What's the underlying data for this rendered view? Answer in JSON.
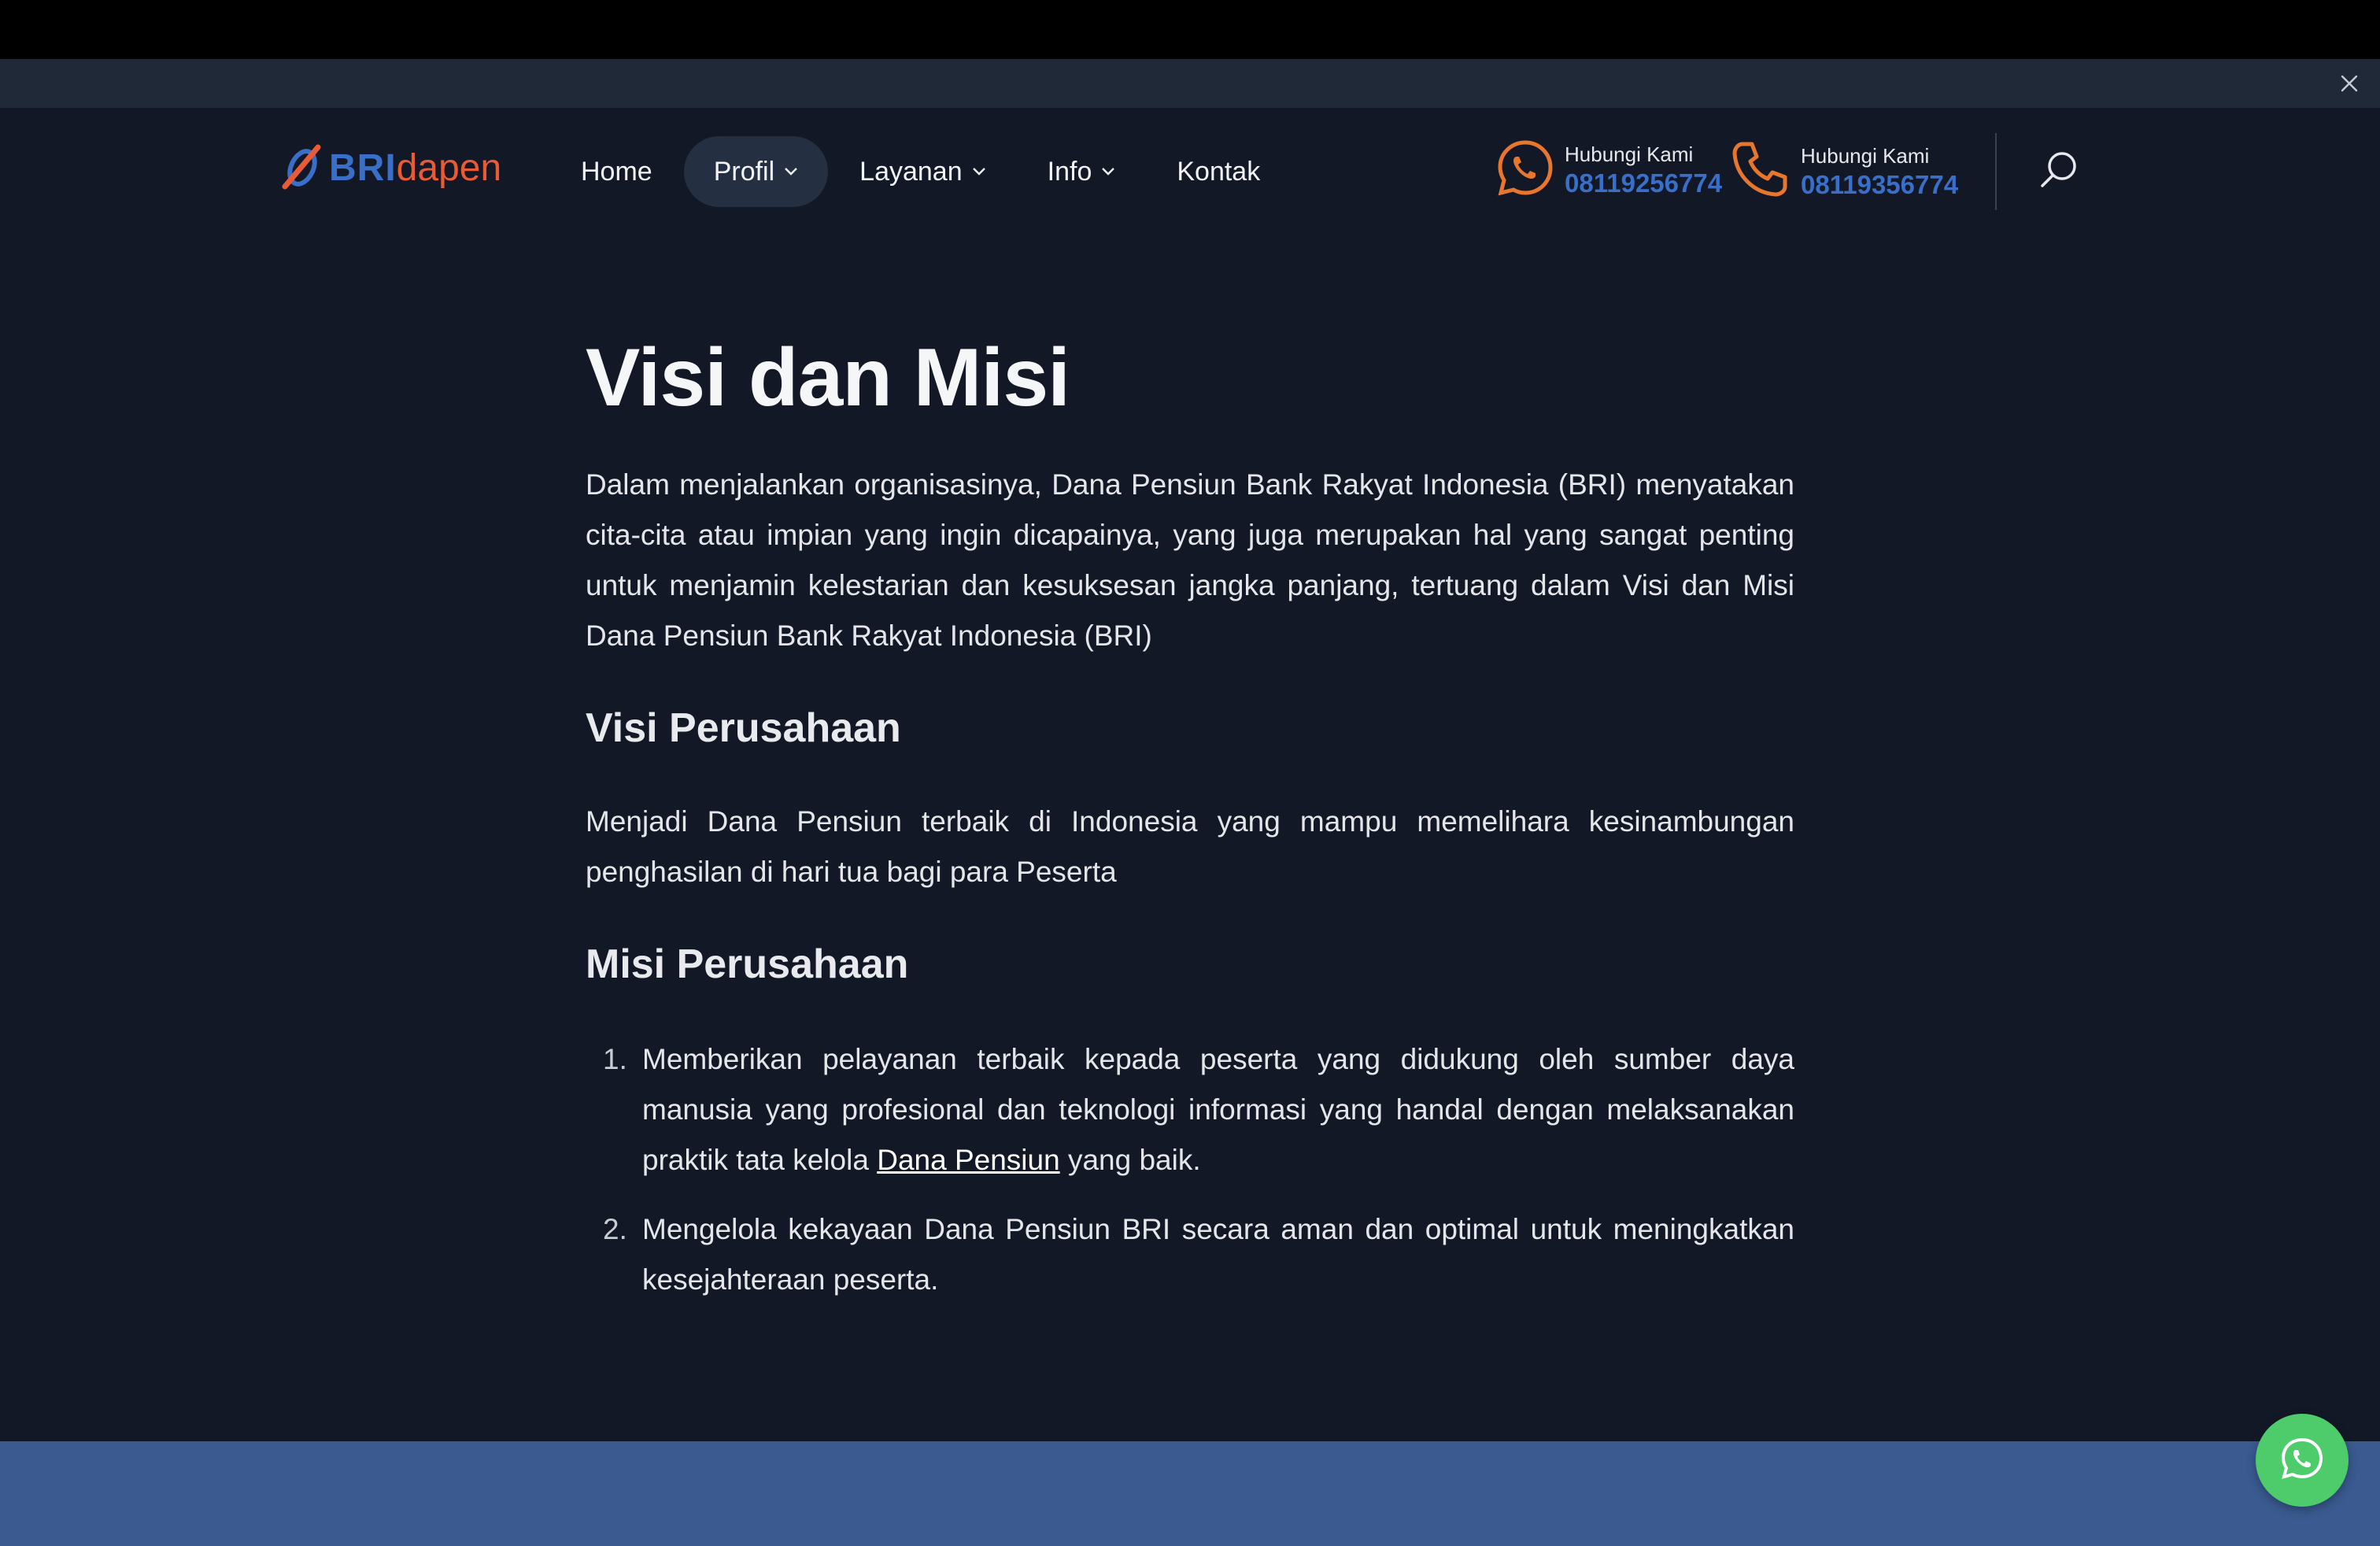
{
  "nav": {
    "logo_primary": "BRI",
    "logo_secondary": "dapen",
    "items": [
      {
        "label": "Home"
      },
      {
        "label": "Profil"
      },
      {
        "label": "Layanan"
      },
      {
        "label": "Info"
      },
      {
        "label": "Kontak"
      }
    ],
    "contacts": [
      {
        "icon": "whatsapp-icon",
        "label": "Hubungi Kami",
        "number": "08119256774"
      },
      {
        "icon": "phone-icon",
        "label": "Hubungi Kami",
        "number": "08119356774"
      }
    ]
  },
  "content": {
    "title": "Visi dan Misi",
    "intro": "Dalam menjalankan organisasinya, Dana Pensiun Bank Rakyat Indonesia (BRI) menyatakan cita-cita atau impian yang ingin dicapainya, yang juga merupakan hal yang sangat penting untuk menjamin kelestarian dan kesuksesan jangka panjang, tertuang dalam Visi dan Misi Dana Pensiun Bank Rakyat Indonesia (BRI)",
    "visi_heading": "Visi Perusahaan",
    "visi_text": "Menjadi Dana Pensiun terbaik di Indonesia yang mampu memelihara kesinambungan penghasilan di hari tua bagi para Peserta",
    "misi_heading": "Misi Perusahaan",
    "misi": [
      {
        "num": "1.",
        "before": "Memberikan pelayanan terbaik kepada peserta yang didukung oleh sumber daya manusia yang profesional dan teknologi informasi yang handal dengan melaksanakan praktik tata kelola ",
        "link": "Dana Pensiun",
        "after": " yang baik."
      },
      {
        "num": "2.",
        "text": "Mengelola kekayaan Dana Pensiun BRI secara aman dan optimal untuk meningkatkan kesejahteraan peserta."
      }
    ]
  },
  "colors": {
    "background": "#121826",
    "accent_blue": "#3a6fc9",
    "accent_orange": "#e8762c",
    "whatsapp_green": "#4ecb6b",
    "footer": "#3a5a90"
  }
}
